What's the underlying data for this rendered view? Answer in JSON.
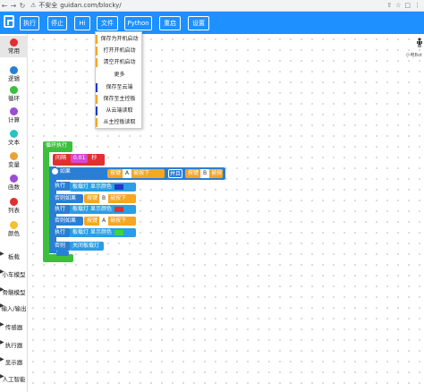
{
  "browser": {
    "security": "不安全",
    "url": "guidan.com/blocky/"
  },
  "toolbar": {
    "buttons": [
      "执行",
      "停止",
      "Hi",
      "文件",
      "Python",
      "重启",
      "设置"
    ]
  },
  "file_menu": {
    "items": [
      "保存为开机启动",
      "打开开机启动",
      "清空开机启动",
      "更多",
      "保存至云端",
      "保存至主控板",
      "从云端读取",
      "从主控板读取"
    ],
    "bar_colors": [
      "#f5a623",
      "#f5a623",
      "#f5a623",
      "#ffffff",
      "#1e3cc8",
      "#f5a623",
      "#1e3cc8",
      "#f5a623"
    ]
  },
  "categories": [
    {
      "label": "常用",
      "color": "#e03030"
    },
    {
      "label": "逻辑",
      "color": "#2a7fd4"
    },
    {
      "label": "循环",
      "color": "#3dbf3d"
    },
    {
      "label": "计算",
      "color": "#9b4dd3"
    },
    {
      "label": "文本",
      "color": "#25c4c4"
    },
    {
      "label": "变量",
      "color": "#e8a33a"
    },
    {
      "label": "函数",
      "color": "#9b4dd3"
    },
    {
      "label": "列表",
      "color": "#e03030"
    },
    {
      "label": "颜色",
      "color": "#f2c12e"
    }
  ],
  "sections": [
    "板载",
    "小车模型",
    "骨骼模型",
    "输入/输出",
    "传感器",
    "执行器",
    "显示器",
    "人工智能"
  ],
  "blocks": {
    "loop": "循环执行",
    "wait": "间隔",
    "wait_val": "0.01",
    "wait_unit": "秒",
    "if": "如果",
    "btn": "按键",
    "btn_a": "A",
    "pressed": "被按下",
    "and": "并且",
    "btn_b": "B",
    "do": "执行",
    "led": "板载灯",
    "show_color": "显示颜色",
    "elif": "否则如果",
    "else": "否则",
    "led_off": "关闭板载灯"
  },
  "right_label": "小电Bot"
}
